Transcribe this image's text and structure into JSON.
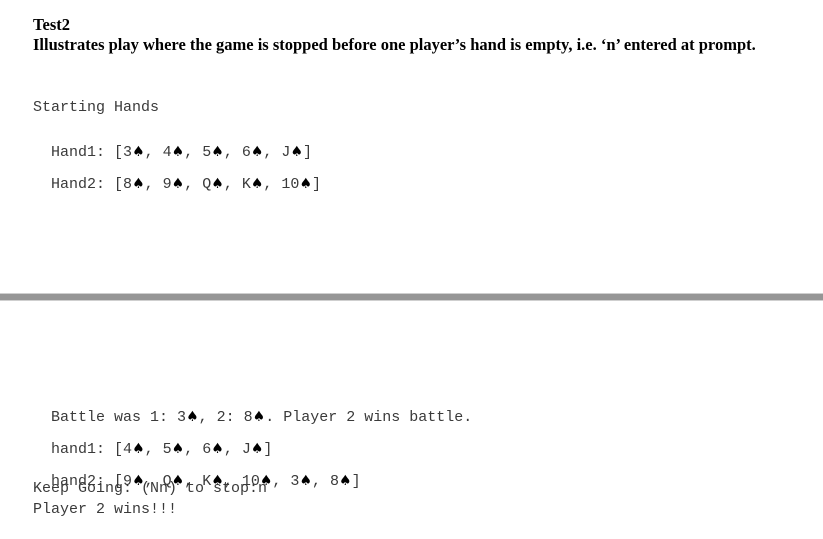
{
  "header": {
    "title": "Test2",
    "description": "Illustrates play where the game is stopped before one player’s hand is empty, i.e. ‘n’ entered at prompt."
  },
  "top_section": {
    "label": "Starting Hands",
    "hand1_prefix": "Hand1: ",
    "hand1_cards": [
      "3",
      "4",
      "5",
      "6",
      "J"
    ],
    "hand2_prefix": "Hand2: ",
    "hand2_cards": [
      "8",
      "9",
      "Q",
      "K",
      "10"
    ]
  },
  "bottom_section": {
    "battle_line": {
      "prefix": "Battle was 1: ",
      "card1": "3",
      "middle": ", 2: ",
      "card2": "8",
      "suffix": ". Player 2 wins battle."
    },
    "hand1_prefix": "hand1: ",
    "hand1_cards": [
      "4",
      "5",
      "6",
      "J"
    ],
    "hand2_prefix": "hand2: ",
    "hand2_cards": [
      "9",
      "Q",
      "K",
      "10",
      "3",
      "8"
    ],
    "prompt": "Keep Going: (Nn) to stop:n",
    "result": "Player 2 wins!!!"
  },
  "suit_symbol": "♠",
  "colors": {
    "separator": "#969696",
    "console_text": "#3a3a3a",
    "suit": "#000000"
  }
}
